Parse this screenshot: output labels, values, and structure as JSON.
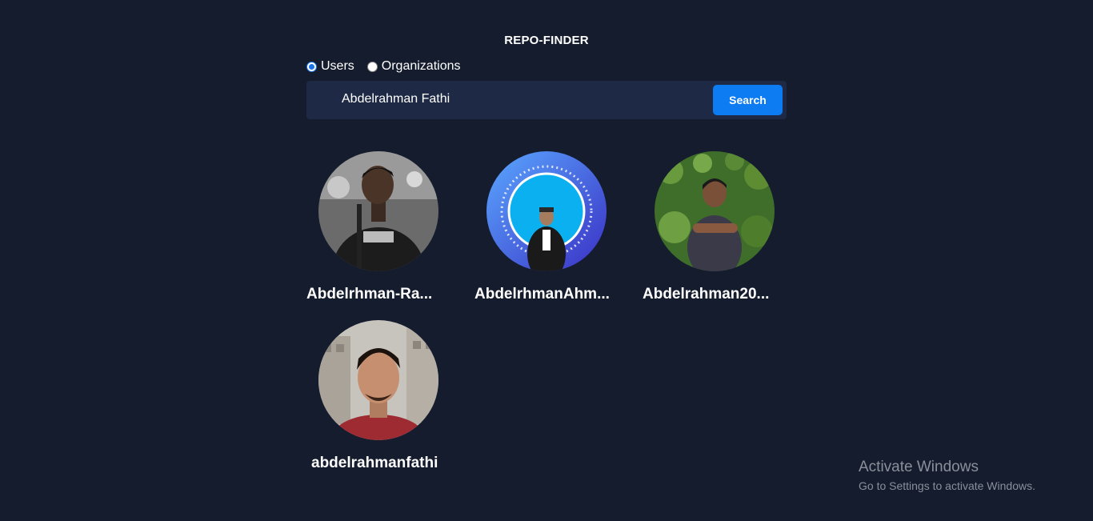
{
  "app": {
    "title": "REPO-FINDER"
  },
  "search_type": {
    "options": [
      {
        "label": "Users",
        "checked": true
      },
      {
        "label": "Organizations",
        "checked": false
      }
    ]
  },
  "search": {
    "value": "Abdelrahman Fathi",
    "button_label": "Search"
  },
  "results": [
    {
      "name": "Abdelrhman-Ra...",
      "avatar": "user-avatar-photo-bw"
    },
    {
      "name": "AbdelrhmanAhm...",
      "avatar": "user-avatar-photo-blue"
    },
    {
      "name": "Abdelrahman20...",
      "avatar": "user-avatar-photo-green"
    },
    {
      "name": "abdelrahmanfathi",
      "avatar": "user-avatar-photo-red"
    }
  ],
  "watermark": {
    "title": "Activate Windows",
    "subtitle": "Go to Settings to activate Windows."
  },
  "colors": {
    "background": "#141c2e",
    "search_bar": "#1e2a45",
    "accent": "#0d7cf2"
  }
}
